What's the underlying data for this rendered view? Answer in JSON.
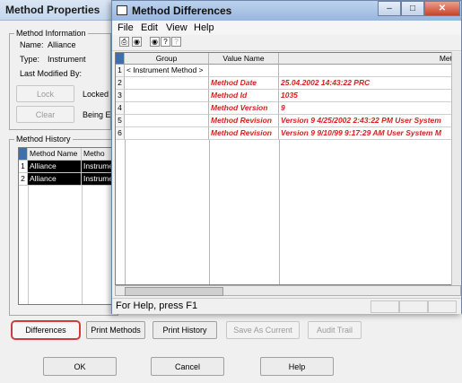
{
  "props": {
    "title": "Method Properties",
    "info_group": "Method Information",
    "name_label": "Name:",
    "name_value": "Alliance",
    "type_label": "Type:",
    "type_value": "Instrument",
    "last_modified_label": "Last Modified By:",
    "lock_button": "Lock",
    "clear_button": "Clear",
    "locked_label": "Locked",
    "being_label": "Being E",
    "history_group": "Method History",
    "history_columns": [
      "Method Name",
      "Metho"
    ],
    "history_rows": [
      {
        "num": "1",
        "name": "Alliance",
        "type": "Instrume"
      },
      {
        "num": "2",
        "name": "Alliance",
        "type": "Instrume"
      }
    ],
    "buttons": {
      "differences": "Differences",
      "print_methods": "Print Methods",
      "print_history": "Print History",
      "save_as_current": "Save As Current",
      "audit_trail": "Audit Trail",
      "ok": "OK",
      "cancel": "Cancel",
      "help": "Help"
    }
  },
  "diff": {
    "title": "Method Differences",
    "menu": [
      "File",
      "Edit",
      "View",
      "Help"
    ],
    "columns": [
      "Group",
      "Value Name",
      "Met"
    ],
    "rows": [
      {
        "num": "1",
        "group": "< Instrument Method >",
        "name": "",
        "value": ""
      },
      {
        "num": "2",
        "group": "",
        "name": "Method Date",
        "value": "25.04.2002 14:43:22 PRC"
      },
      {
        "num": "3",
        "group": "",
        "name": "Method Id",
        "value": "1035"
      },
      {
        "num": "4",
        "group": "",
        "name": "Method Version",
        "value": "9"
      },
      {
        "num": "5",
        "group": "",
        "name": "Method Revision",
        "value": "Version 9  4/25/2002 2:43:22 PM  User System"
      },
      {
        "num": "6",
        "group": "",
        "name": "Method Revision",
        "value": "Version 9  9/10/99 9:17:29 AM  User System     M"
      }
    ],
    "status": "For Help, press F1"
  },
  "colors": {
    "diff_text": "#d91e1e",
    "focus_outline": "#d23b3b"
  }
}
